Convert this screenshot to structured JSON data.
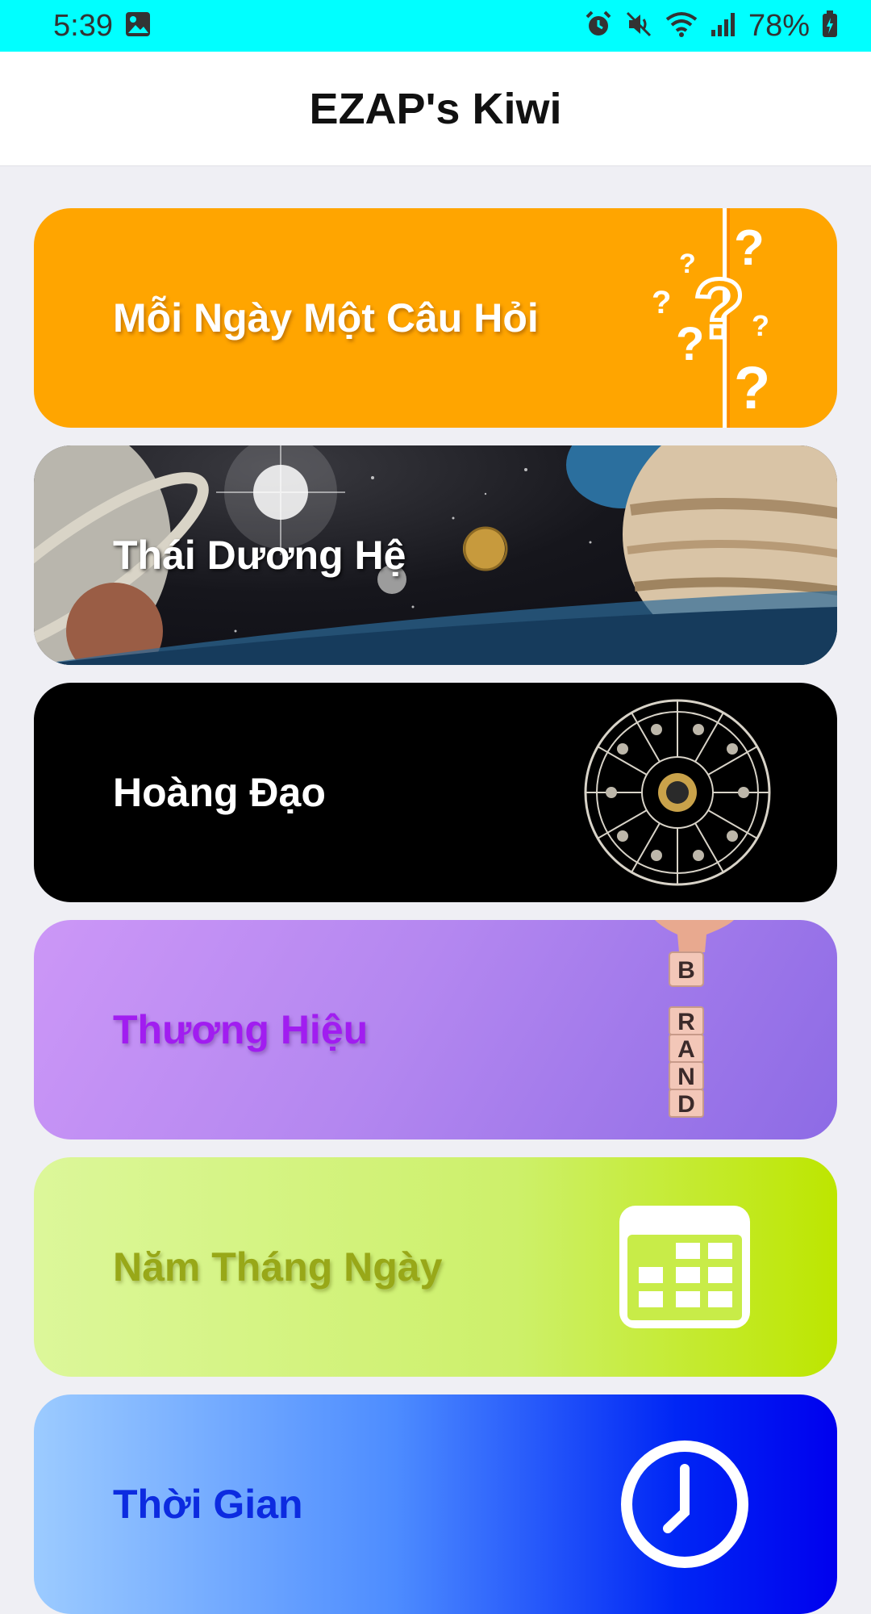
{
  "status_bar": {
    "time": "5:39",
    "battery_percent": "78%",
    "icons": [
      "image-icon",
      "alarm-icon",
      "vibrate-off-icon",
      "wifi-icon",
      "signal-icon",
      "battery-charging-icon"
    ]
  },
  "app_bar": {
    "title": "EZAP's Kiwi"
  },
  "menu": {
    "items": [
      {
        "label": "Mỗi Ngày Một Câu Hỏi",
        "icon": "question-marks-icon",
        "color": "#ffa500"
      },
      {
        "label": "Thái Dương Hệ",
        "icon": "solar-system-image",
        "color": "#111118"
      },
      {
        "label": "Hoàng Đạo",
        "icon": "zodiac-wheel-icon",
        "color": "#000000"
      },
      {
        "label": "Thương Hiệu",
        "icon": "brand-blocks-image",
        "color": "#b487f0"
      },
      {
        "label": "Năm Tháng Ngày",
        "icon": "calendar-icon",
        "color": "#cdf06a"
      },
      {
        "label": "Thời Gian",
        "icon": "clock-icon",
        "color": "#0026f5"
      }
    ]
  },
  "colors": {
    "status_bar_bg": "#00ffff",
    "page_bg": "#efeff4",
    "brand_label": "#a11df0",
    "date_label": "#98a818",
    "time_label": "#0c2be0"
  },
  "brand_letters": [
    "B",
    "R",
    "A",
    "N",
    "D"
  ]
}
